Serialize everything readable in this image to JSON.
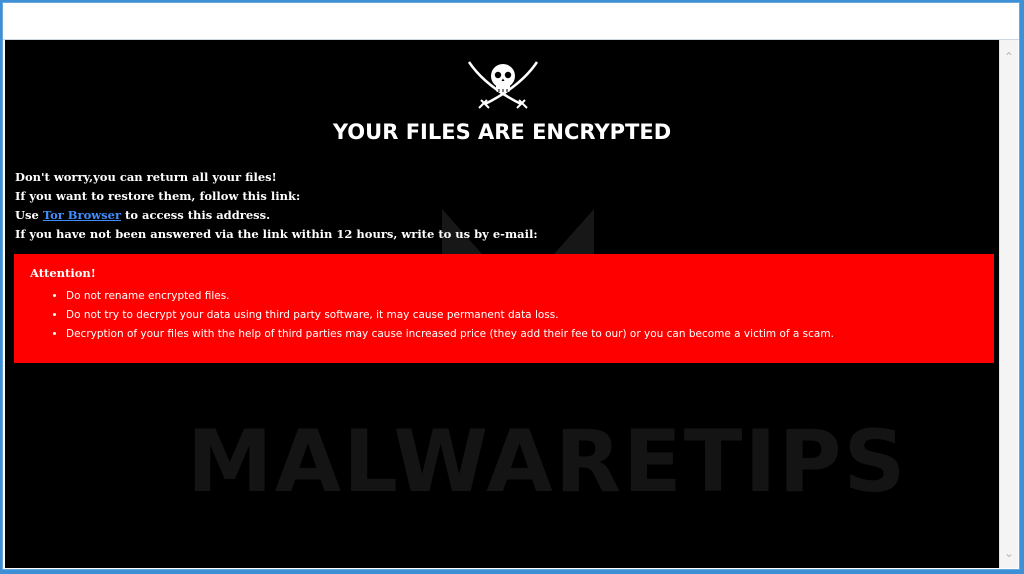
{
  "ransom_note": {
    "headline": "YOUR FILES ARE ENCRYPTED",
    "line1": "Don't worry,you can return all your files!",
    "line2": "If you want to restore them, follow this link:",
    "line3_prefix": "Use ",
    "tor_link": "Tor Browser",
    "line3_suffix": " to access this address.",
    "line4": "If you have not been answered via the link within 12 hours, write to us by e-mail:",
    "attention_title": "Attention!",
    "attention_items": [
      "Do not rename encrypted files.",
      "Do not try to decrypt your data using third party software, it may cause permanent data loss.",
      "Decryption of your files with the help of third parties may cause increased price (they add their fee to our) or you can become a victim of a scam."
    ]
  },
  "watermark": "MALWARETIPS",
  "colors": {
    "background": "#000000",
    "attention_box": "#ff0000",
    "link": "#3f8fff",
    "frame": "#3d8fd6"
  },
  "icons": {
    "emblem": "skull-crossed-sabers-icon",
    "scroll_up": "chevron-up-icon",
    "scroll_down": "chevron-down-icon"
  }
}
